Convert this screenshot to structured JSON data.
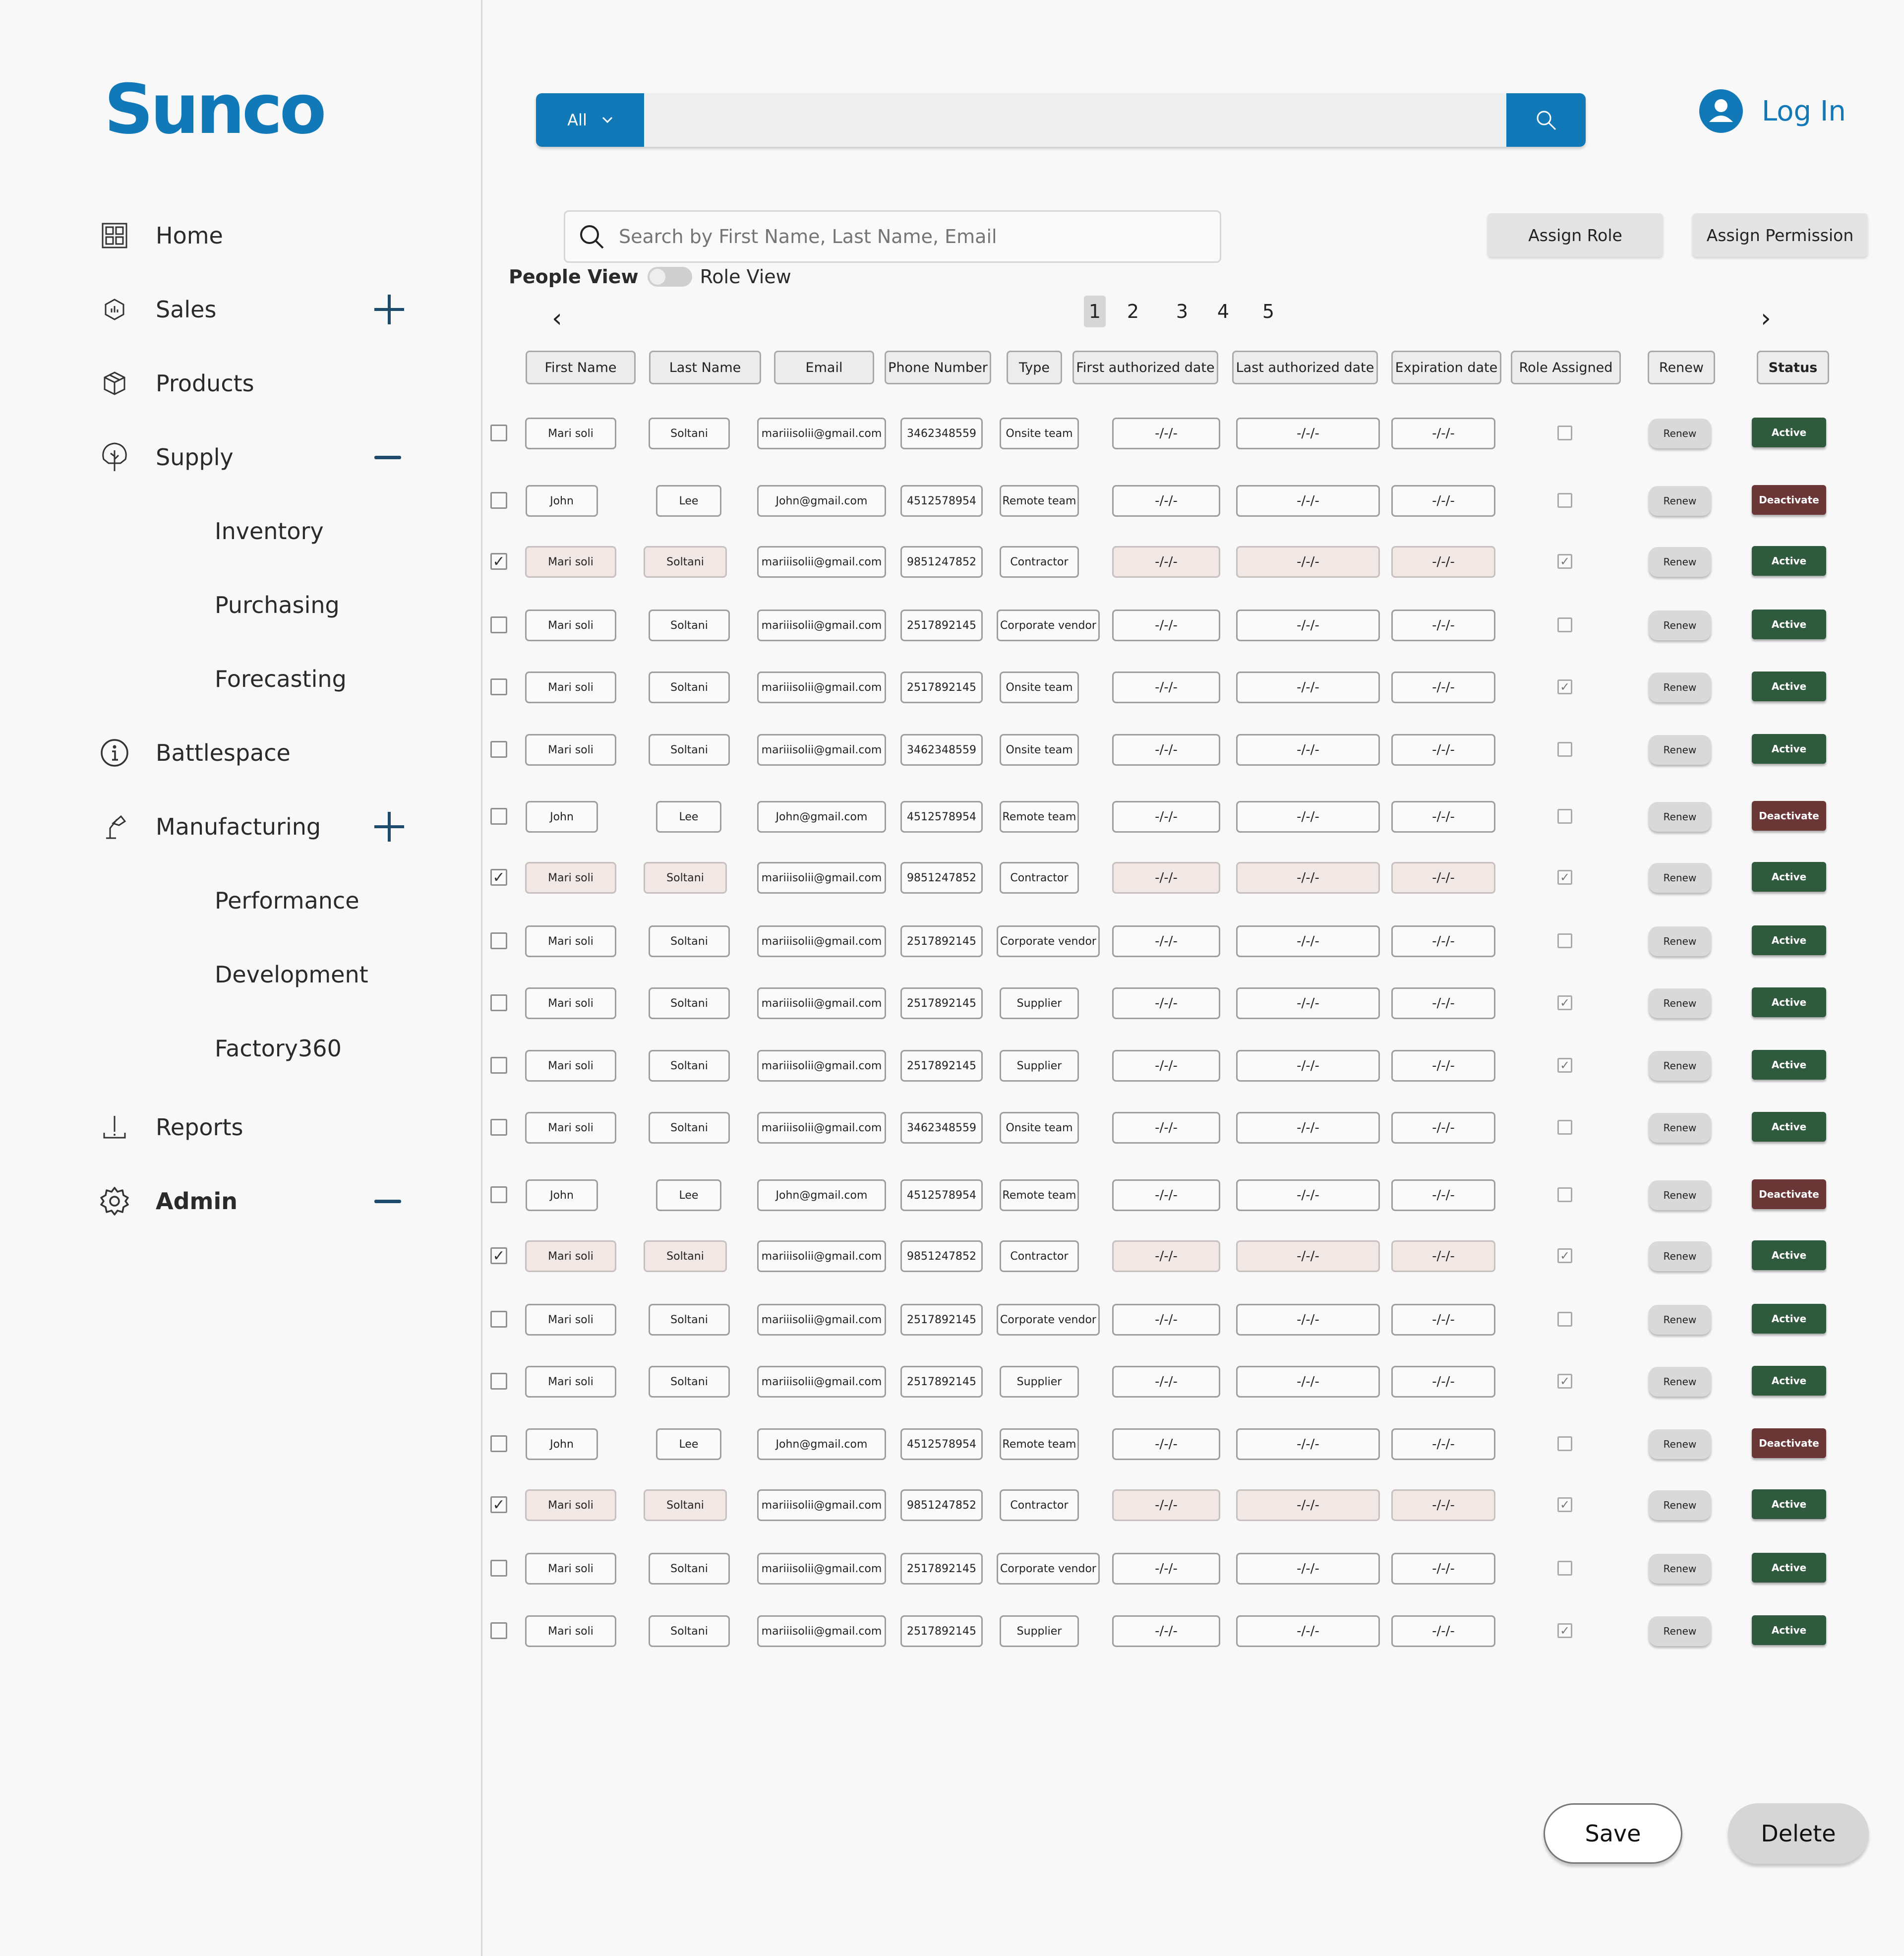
{
  "brand": {
    "logo": "Sunco",
    "color": "#1279b8"
  },
  "sidebar": {
    "items": [
      {
        "label": "Home",
        "icon": "dashboard-icon",
        "level": 0
      },
      {
        "label": "Sales",
        "icon": "hexagon-icon",
        "level": 0,
        "expander": "plus"
      },
      {
        "label": "Products",
        "icon": "package-icon",
        "level": 0
      },
      {
        "label": "Supply",
        "icon": "tree-icon",
        "level": 0,
        "expander": "minus"
      },
      {
        "label": "Inventory",
        "level": 1
      },
      {
        "label": "Purchasing",
        "level": 1
      },
      {
        "label": "Forecasting",
        "level": 1
      },
      {
        "label": "Battlespace",
        "icon": "info-icon",
        "level": 0
      },
      {
        "label": "Manufacturing",
        "icon": "lamp-icon",
        "level": 0,
        "expander": "plus"
      },
      {
        "label": "Performance",
        "level": 1
      },
      {
        "label": "Development",
        "level": 1
      },
      {
        "label": "Factory360",
        "level": 1
      },
      {
        "label": "Reports",
        "icon": "download-icon",
        "level": 0
      },
      {
        "label": "Admin",
        "icon": "gear-icon",
        "level": 0,
        "expander": "minus",
        "active": true
      }
    ]
  },
  "topbar": {
    "category": "All",
    "search_icon": "search-icon",
    "login": "Log In"
  },
  "toolbar": {
    "search_placeholder": "Search by First Name, Last Name, Email",
    "assign_role": "Assign Role",
    "assign_permission": "Assign Permission",
    "people_view": "People View",
    "role_view": "Role View"
  },
  "pagination": {
    "pages": [
      "1",
      "2",
      "3",
      "4",
      "5"
    ],
    "current": "1"
  },
  "table": {
    "headers": [
      "First Name",
      "Last Name",
      "Email",
      "Phone Number",
      "Type",
      "First authorized date",
      "Last authorized date",
      "Expiration date",
      "Role Assigned",
      "Renew",
      "Status"
    ],
    "renew_label": "Renew",
    "date_placeholder": "-/-/-",
    "rows": [
      {
        "checked": false,
        "first": "Mari soli",
        "last": "Soltani",
        "email": "mariiisolii@gmail.com",
        "phone": "3462348559",
        "type": "Onsite team",
        "role": false,
        "status": "Active"
      },
      {
        "checked": false,
        "first": "John",
        "last": "Lee",
        "email": "John@gmail.com",
        "phone": "4512578954",
        "type": "Remote team",
        "role": false,
        "status": "Deactivate"
      },
      {
        "checked": true,
        "first": "Mari soli",
        "last": "Soltani",
        "email": "mariiisolii@gmail.com",
        "phone": "9851247852",
        "type": "Contractor",
        "role": true,
        "status": "Active"
      },
      {
        "checked": false,
        "first": "Mari soli",
        "last": "Soltani",
        "email": "mariiisolii@gmail.com",
        "phone": "2517892145",
        "type": "Corporate vendor",
        "role": false,
        "status": "Active"
      },
      {
        "checked": false,
        "first": "Mari soli",
        "last": "Soltani",
        "email": "mariiisolii@gmail.com",
        "phone": "2517892145",
        "type": "Onsite team",
        "role": true,
        "status": "Active"
      },
      {
        "checked": false,
        "first": "Mari soli",
        "last": "Soltani",
        "email": "mariiisolii@gmail.com",
        "phone": "3462348559",
        "type": "Onsite team",
        "role": false,
        "status": "Active"
      },
      {
        "checked": false,
        "first": "John",
        "last": "Lee",
        "email": "John@gmail.com",
        "phone": "4512578954",
        "type": "Remote team",
        "role": false,
        "status": "Deactivate"
      },
      {
        "checked": true,
        "first": "Mari soli",
        "last": "Soltani",
        "email": "mariiisolii@gmail.com",
        "phone": "9851247852",
        "type": "Contractor",
        "role": true,
        "status": "Active"
      },
      {
        "checked": false,
        "first": "Mari soli",
        "last": "Soltani",
        "email": "mariiisolii@gmail.com",
        "phone": "2517892145",
        "type": "Corporate vendor",
        "role": false,
        "status": "Active"
      },
      {
        "checked": false,
        "first": "Mari soli",
        "last": "Soltani",
        "email": "mariiisolii@gmail.com",
        "phone": "2517892145",
        "type": "Supplier",
        "role": true,
        "status": "Active"
      },
      {
        "checked": false,
        "first": "Mari soli",
        "last": "Soltani",
        "email": "mariiisolii@gmail.com",
        "phone": "2517892145",
        "type": "Supplier",
        "role": true,
        "status": "Active"
      },
      {
        "checked": false,
        "first": "Mari soli",
        "last": "Soltani",
        "email": "mariiisolii@gmail.com",
        "phone": "3462348559",
        "type": "Onsite team",
        "role": false,
        "status": "Active"
      },
      {
        "checked": false,
        "first": "John",
        "last": "Lee",
        "email": "John@gmail.com",
        "phone": "4512578954",
        "type": "Remote team",
        "role": false,
        "status": "Deactivate"
      },
      {
        "checked": true,
        "first": "Mari soli",
        "last": "Soltani",
        "email": "mariiisolii@gmail.com",
        "phone": "9851247852",
        "type": "Contractor",
        "role": true,
        "status": "Active"
      },
      {
        "checked": false,
        "first": "Mari soli",
        "last": "Soltani",
        "email": "mariiisolii@gmail.com",
        "phone": "2517892145",
        "type": "Corporate vendor",
        "role": false,
        "status": "Active"
      },
      {
        "checked": false,
        "first": "Mari soli",
        "last": "Soltani",
        "email": "mariiisolii@gmail.com",
        "phone": "2517892145",
        "type": "Supplier",
        "role": true,
        "status": "Active"
      },
      {
        "checked": false,
        "first": "John",
        "last": "Lee",
        "email": "John@gmail.com",
        "phone": "4512578954",
        "type": "Remote team",
        "role": false,
        "status": "Deactivate"
      },
      {
        "checked": true,
        "first": "Mari soli",
        "last": "Soltani",
        "email": "mariiisolii@gmail.com",
        "phone": "9851247852",
        "type": "Contractor",
        "role": true,
        "status": "Active"
      },
      {
        "checked": false,
        "first": "Mari soli",
        "last": "Soltani",
        "email": "mariiisolii@gmail.com",
        "phone": "2517892145",
        "type": "Corporate vendor",
        "role": false,
        "status": "Active"
      },
      {
        "checked": false,
        "first": "Mari soli",
        "last": "Soltani",
        "email": "mariiisolii@gmail.com",
        "phone": "2517892145",
        "type": "Supplier",
        "role": true,
        "status": "Active"
      }
    ]
  },
  "footer": {
    "save": "Save",
    "delete": "Delete"
  },
  "colors": {
    "active": "#2f5a3e",
    "deactivate": "#6b3636",
    "accent": "#1279b8"
  }
}
